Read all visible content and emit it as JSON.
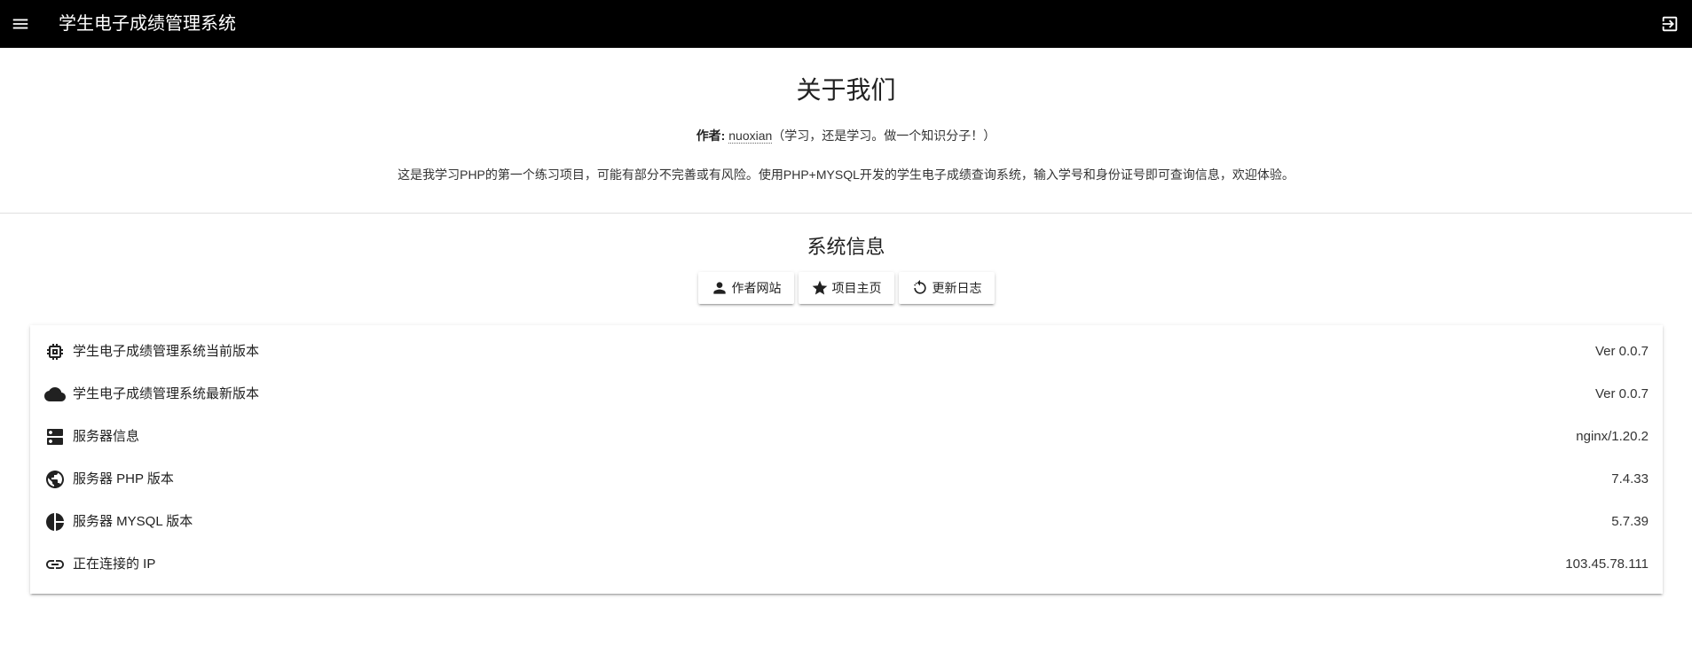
{
  "appbar": {
    "title": "学生电子成绩管理系统",
    "menu_icon": "menu-icon",
    "logout_icon": "exit-icon"
  },
  "about": {
    "heading": "关于我们",
    "author_label": "作者:",
    "author_name": "nuoxian",
    "author_motto": "（学习，还是学习。做一个知识分子！）",
    "description": "这是我学习PHP的第一个练习项目，可能有部分不完善或有风险。使用PHP+MYSQL开发的学生电子成绩查询系统，输入学号和身份证号即可查询信息，欢迎体验。"
  },
  "sysinfo": {
    "heading": "系统信息",
    "buttons": [
      {
        "label": "作者网站",
        "icon": "person-icon"
      },
      {
        "label": "项目主页",
        "icon": "star-icon"
      },
      {
        "label": "更新日志",
        "icon": "refresh-icon"
      }
    ],
    "rows": [
      {
        "icon": "chip-icon",
        "label": "学生电子成绩管理系统当前版本",
        "value": "Ver 0.0.7"
      },
      {
        "icon": "cloud-icon",
        "label": "学生电子成绩管理系统最新版本",
        "value": "Ver 0.0.7"
      },
      {
        "icon": "server-icon",
        "label": "服务器信息",
        "value": "nginx/1.20.2"
      },
      {
        "icon": "globe-icon",
        "label": "服务器 PHP 版本",
        "value": "7.4.33"
      },
      {
        "icon": "pie-chart-icon",
        "label": "服务器 MYSQL 版本",
        "value": "5.7.39"
      },
      {
        "icon": "link-icon",
        "label": "正在连接的 IP",
        "value": "103.45.78.111"
      }
    ]
  }
}
